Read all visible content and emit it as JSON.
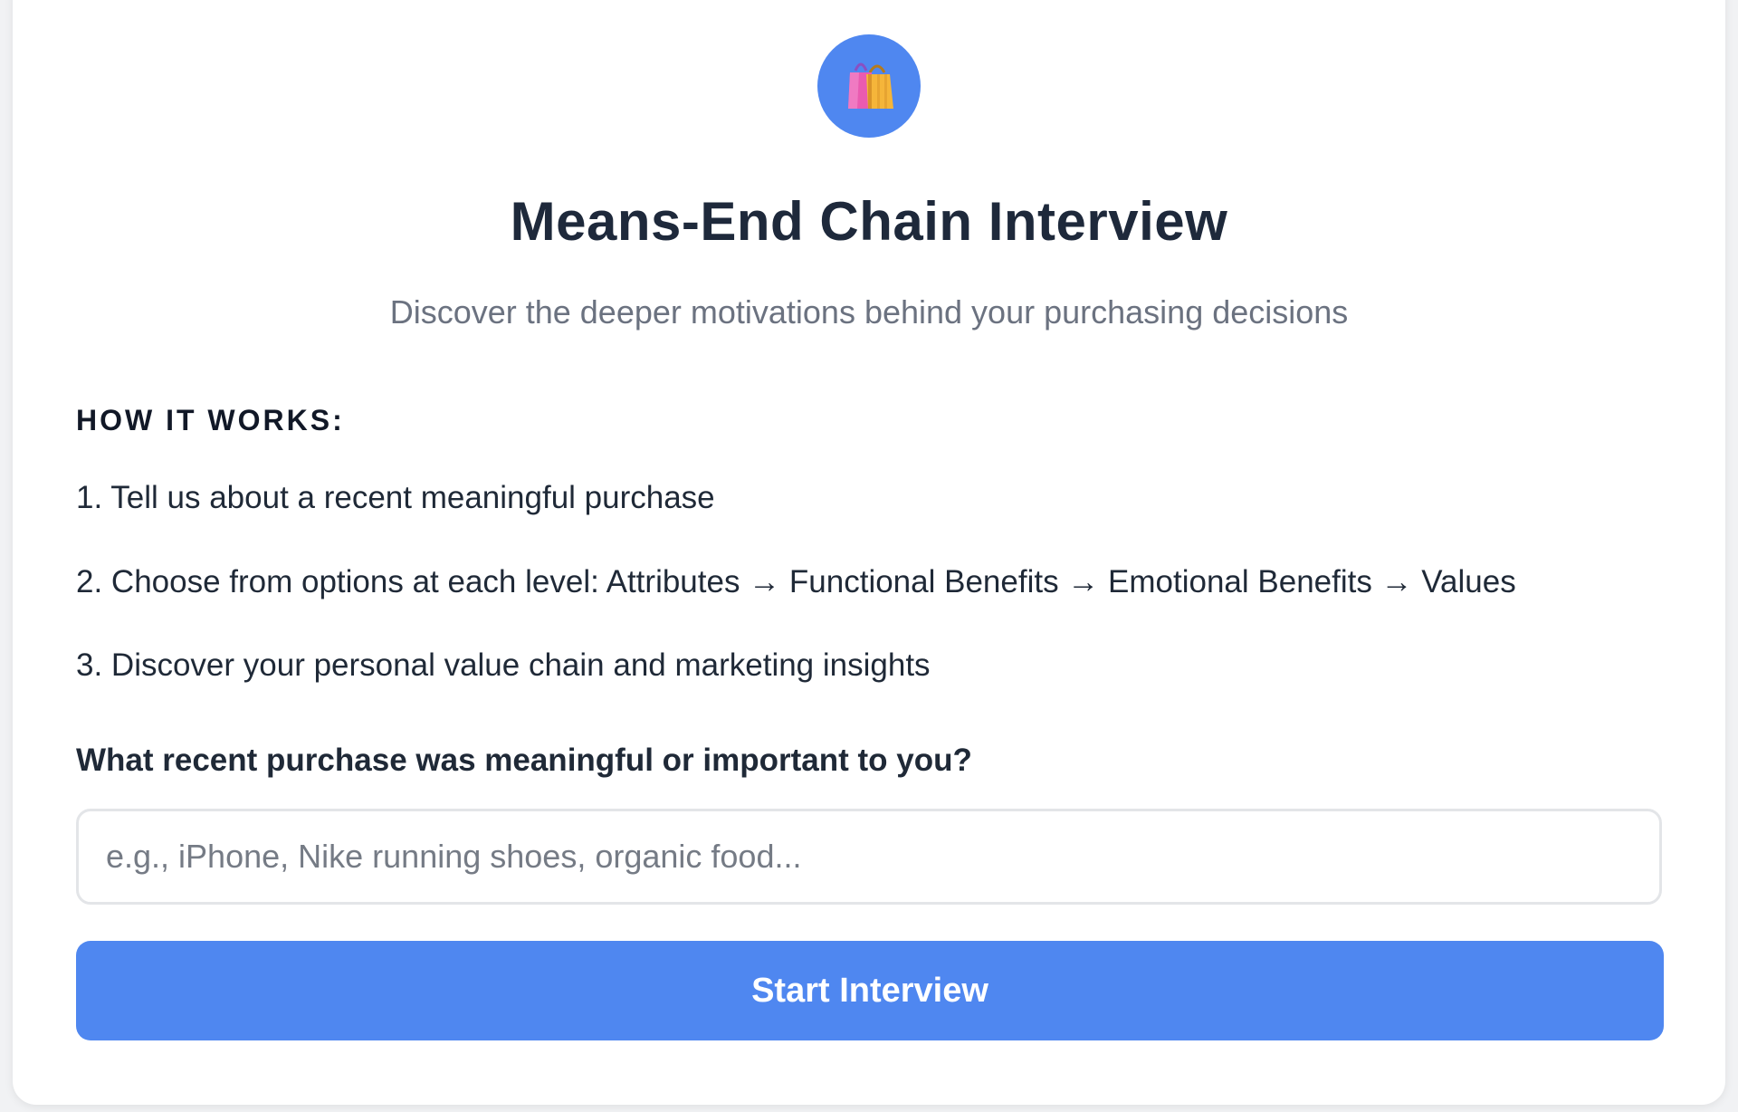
{
  "header": {
    "logo_icon": "shopping-bags-icon",
    "logo_bg_color": "#4f87f0",
    "title": "Means-End Chain Interview",
    "subtitle": "Discover the deeper motivations behind your purchasing decisions"
  },
  "how_it_works": {
    "heading": "HOW IT WORKS:",
    "steps": [
      "1. Tell us about a recent meaningful purchase",
      "2. Choose from options at each level: Attributes → Functional Benefits → Emotional Benefits → Values",
      "3. Discover your personal value chain and marketing insights"
    ]
  },
  "form": {
    "question": "What recent purchase was meaningful or important to you?",
    "input_value": "",
    "input_placeholder": "e.g., iPhone, Nike running shoes, organic food...",
    "start_label": "Start Interview",
    "button_color": "#4f87f0"
  }
}
